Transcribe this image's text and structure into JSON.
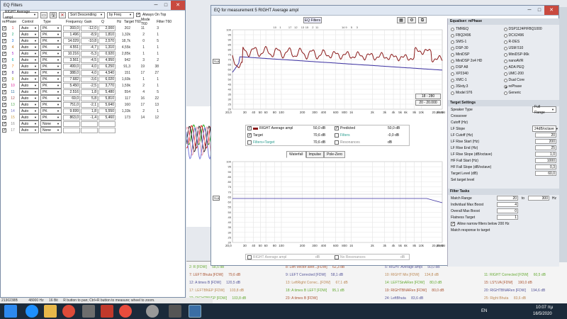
{
  "eq_filters_window": {
    "title": "EQ Filters",
    "measurement": "RIGHT Average ampl",
    "sort": "Sort Descending",
    "sort_by": "by Freq",
    "always_on_top": "Always On Top",
    "headers": [
      "Control",
      "Type",
      "Frequency",
      "Gain",
      "Q",
      "Hz",
      "Target T60",
      "Mode T60",
      "Filter T60"
    ],
    "col0_header": "re/Phase",
    "filters": [
      {
        "n": "1",
        "control": "Auto",
        "type": "PK",
        "freq": "393,0",
        "gain": "-12,0",
        "q": "2,000",
        "hz": "202",
        "t60": "11",
        "mode": "3"
      },
      {
        "n": "2",
        "control": "Auto",
        "type": "PK",
        "freq": "1.496",
        "gain": "-8,9",
        "q": "1,810",
        "hz": "1,32k",
        "t60": "2",
        "mode": "1"
      },
      {
        "n": "3",
        "control": "Auto",
        "type": "PK",
        "freq": "14.029",
        "gain": "-10,8",
        "q": "2,570",
        "hz": "18,7k",
        "t60": "0",
        "mode": "5"
      },
      {
        "n": "4",
        "control": "Auto",
        "type": "PK",
        "freq": "4.551",
        "gain": "-4,7",
        "q": "1,310",
        "hz": "4,55k",
        "t60": "1",
        "mode": "1"
      },
      {
        "n": "5",
        "control": "Auto",
        "type": "PK",
        "freq": "10.216",
        "gain": "-5,3",
        "q": "0,920",
        "hz": "2,85k",
        "t60": "1",
        "mode": "1"
      },
      {
        "n": "6",
        "control": "Auto",
        "type": "PK",
        "freq": "3.561",
        "gain": "-4,5",
        "q": "4,950",
        "hz": "942",
        "t60": "3",
        "mode": "2"
      },
      {
        "n": "7",
        "control": "Auto",
        "type": "PK",
        "freq": "499,0",
        "gain": "4,0",
        "q": "6,250",
        "hz": "91,3",
        "t60": "19",
        "mode": "38"
      },
      {
        "n": "8",
        "control": "Auto",
        "type": "PK",
        "freq": "388,0",
        "gain": "4,0",
        "q": "4,540",
        "hz": "151",
        "t60": "17",
        "mode": "27"
      },
      {
        "n": "9",
        "control": "Auto",
        "type": "PK",
        "freq": "7.682",
        "gain": "-3,6",
        "q": "6,020",
        "hz": "1,60k",
        "t60": "1",
        "mode": "1"
      },
      {
        "n": "10",
        "control": "Auto",
        "type": "PK",
        "freq": "5.450",
        "gain": "-2,5",
        "q": "3,770",
        "hz": "1,59k",
        "t60": "2",
        "mode": "1"
      },
      {
        "n": "11",
        "control": "Auto",
        "type": "PK",
        "freq": "2.516",
        "gain": "1,8",
        "q": "5,480",
        "hz": "554",
        "t60": "4",
        "mode": "5"
      },
      {
        "n": "12",
        "control": "Auto",
        "type": "PK",
        "freq": "69,0",
        "gain": "5,8",
        "q": "5,810",
        "hz": "117",
        "t60": "16",
        "mode": "22"
      },
      {
        "n": "13",
        "control": "Auto",
        "type": "PK",
        "freq": "751,0",
        "gain": "-2,1",
        "q": "5,640",
        "hz": "160",
        "t60": "17",
        "mode": "13"
      },
      {
        "n": "14",
        "control": "Auto",
        "type": "PK",
        "freq": "9.699",
        "gain": "1,8",
        "q": "5,550",
        "hz": "1,33k",
        "t60": "2",
        "mode": "1"
      },
      {
        "n": "15",
        "control": "Auto",
        "type": "PK",
        "freq": "863,0",
        "gain": "-1,4",
        "q": "5,460",
        "hz": "173",
        "t60": "14",
        "mode": "12"
      },
      {
        "n": "16",
        "control": "Auto",
        "type": "None",
        "freq": "",
        "gain": "",
        "q": "",
        "hz": "",
        "t60": "",
        "mode": ""
      },
      {
        "n": "17",
        "control": "Auto",
        "type": "None",
        "freq": "",
        "gain": "",
        "q": "",
        "hz": "",
        "t60": "",
        "mode": ""
      }
    ]
  },
  "eq_window": {
    "title": "EQ for measurement 5 RIGHT Average ampl",
    "eq_filters_button": "EQ Filters",
    "legend": {
      "row1_name": "RIGHT Average ampl",
      "row1_value": "50,0 dB",
      "row1_predicted": "Predicted",
      "row1_pred_value": "50,0 dB",
      "row2_target": "Target",
      "row2_target_value": "70,6 dB",
      "row2_filters": "Filters",
      "row2_filters_value": "-0,0 dB",
      "row3_ft": "Filters+Target",
      "row3_ft_value": "70,6 dB",
      "row3_res": "Resonances",
      "row3_res_value": "dB"
    },
    "range_buttons": [
      "18 - 280",
      "20 - 20.000"
    ],
    "bottom_tabs": [
      "Waterfall",
      "Impulse",
      "Pole-Zero"
    ],
    "bottom_legend_a": "RIGHT Average ampl",
    "bottom_legend_b": "No Resonances",
    "bottom_legend_a_val": "dB",
    "bottom_legend_b_val": "dB",
    "top_plot_y_marker": "75,8",
    "bottom_plot_y_marker": "75,8",
    "plot_x_start": "20,0",
    "plot_x_end": "20,0kHz",
    "x_ticks": [
      "30",
      "40",
      "50",
      "60",
      "80",
      "100",
      "200",
      "300",
      "400",
      "600",
      "800",
      "1k",
      "2k",
      "3k",
      "4k",
      "5k",
      "6k",
      "8k",
      "10k",
      "20,0kHz"
    ],
    "y_ticks_top": [
      "100",
      "95",
      "90",
      "85",
      "80",
      "75",
      "70",
      "65",
      "60",
      "55",
      "50",
      "45",
      "40",
      "35",
      "30",
      "25",
      "20"
    ],
    "modes_labels": [
      "10",
      "1",
      "17",
      "12",
      "13",
      "15",
      "2",
      "11",
      "14",
      "9",
      "5",
      "3"
    ],
    "y_ticks_bottom": [
      "100",
      "95",
      "90",
      "85",
      "80",
      "75",
      "70",
      "65",
      "60",
      "55",
      "50",
      "45",
      "40",
      "35",
      "30",
      "25",
      "20"
    ]
  },
  "right_panel": {
    "equaliser_title": "Equaliser: rePhase",
    "equalisers": [
      [
        "TMREQ",
        "DSP1124P/FBQ1000"
      ],
      [
        "FBQ2496",
        "DCX2496"
      ],
      [
        "SMS-1",
        "R-DES"
      ],
      [
        "DSP-30",
        "USM 510"
      ],
      [
        "MiniDSP",
        "MiniDSP-96k"
      ],
      [
        "MiniDSP 2x4 HD",
        "nanoAVR"
      ],
      [
        "DSP A8",
        "ADA PEQ"
      ],
      [
        "XP2340",
        "UMC-200"
      ],
      [
        "XMC-1",
        "Dual Core"
      ],
      [
        "3Sixty.3",
        "rePhase"
      ],
      [
        "Model 976",
        "Generic"
      ]
    ],
    "selected_equaliser": "rePhase",
    "target_title": "Target Settings",
    "speaker_type_label": "Speaker Type",
    "speaker_type": "Full Range",
    "crossover": "Crossover",
    "cutoff_label": "Cutoff (Hz)",
    "lf_slope_label": "LF Slope",
    "lf_slope": "24dB/octave",
    "lf_cutoff_label": "LF Cutoff (Hz)",
    "lf_cutoff": "20",
    "lf_rise_start_label": "LF Rise Start (Hz)",
    "lf_rise_start": "200",
    "lf_rise_end_label": "LF Rise End (Hz)",
    "lf_rise_end": "25",
    "lf_rise_slope_label": "LF Rise Slope (dB/octave)",
    "lf_rise_slope": "1,0",
    "hf_fall_start_label": "HF Fall Start (Hz)",
    "hf_fall_start": "1000",
    "hf_fall_slope_label": "HF Fall Slope (dB/octave)",
    "hf_fall_slope": "0,3",
    "target_level_label": "Target Level (dB)",
    "target_level": "60,0",
    "set_target_level": "Set target level",
    "filter_tasks_title": "Filter Tasks",
    "match_range_label": "Match Range",
    "match_range_from": "20",
    "match_range_to_label": "to",
    "match_range_to": "300",
    "match_range_unit": "Hz",
    "indiv_max_boost_label": "Individual Max Boost",
    "indiv_max_boost": "4",
    "overall_max_boost_label": "Overall Max Boost",
    "overall_max_boost": "0",
    "flatness_label": "Flatness Target",
    "flatness": "1",
    "allow_narrow": "Allow narrow filters below 200 Hz",
    "match_response": "Match response to target"
  },
  "bg_legend": [
    {
      "c1": "2: R [FDW]",
      "c1v": "58,5 dB",
      "c2": "8: Left Vector aver...[FDW]",
      "c2v": "62,3 dB",
      "c3": "5: RIGHT Average ampl",
      "c3v": "50,0 dB"
    },
    {
      "c1": "7: LEFT Bhuta [FDW]",
      "c1v": "79,6 dB",
      "c2": "9: LEFT Corrected [FDW]",
      "c2v": "58,1 dB",
      "c3": "10: RIGHT Mix [FDW]",
      "c3v": "134,8 dB",
      "c4": "11: RIGHT Corrected [FDW]",
      "c4v": "60,5 dB"
    },
    {
      "c1": "12: A times B [FDW]",
      "c1v": "120,5 dB",
      "c2": "13: LeftRight Correc...[FDW]",
      "c2v": "67,1 dB",
      "c3": "14: LEFTSinARen [FDW]",
      "c3v": "80,0 dB",
      "c4": "15: LS*LVA [FDW]",
      "c4v": "190,0 dB"
    },
    {
      "c1": "17: LEFTBNEP [FDW]",
      "c1v": "103,8 dB",
      "c2": "18: A times B LEFT [FDW]",
      "c2v": "95,1 dB",
      "c3": "19: RIGHTBNARen [FDW]",
      "c3v": "80,0 dB",
      "c4": "20: RIGHTBNARen [FDW]",
      "c4v": "194,6 dB"
    },
    {
      "c1": "22: RIGHTBNEP [FDW]",
      "c1v": "103,8 dB",
      "c2": "23: A times B [FDW]",
      "c2v": "",
      "c3": "24: LeftBhuta",
      "c3v": "83,6 dB",
      "c4": "25: Right Bhuta",
      "c4v": "83,6 dB"
    }
  ],
  "bg_right_legend_top": "21: RIGHT Average... [FDW]",
  "statusbar": {
    "left": "2130238B",
    "rate": "48000 Hz",
    "bits": "16 Bit",
    "hint": "R button to pan; Ctrl+R button to measure; wheel to zoom."
  },
  "taskbar": {
    "lang": "EN",
    "time": "10:07 πμ",
    "date": "16/5/2020"
  },
  "colors": {
    "measurement": "#8b1a1a",
    "target": "#3a2fa0",
    "accent": "#2d6db5"
  }
}
